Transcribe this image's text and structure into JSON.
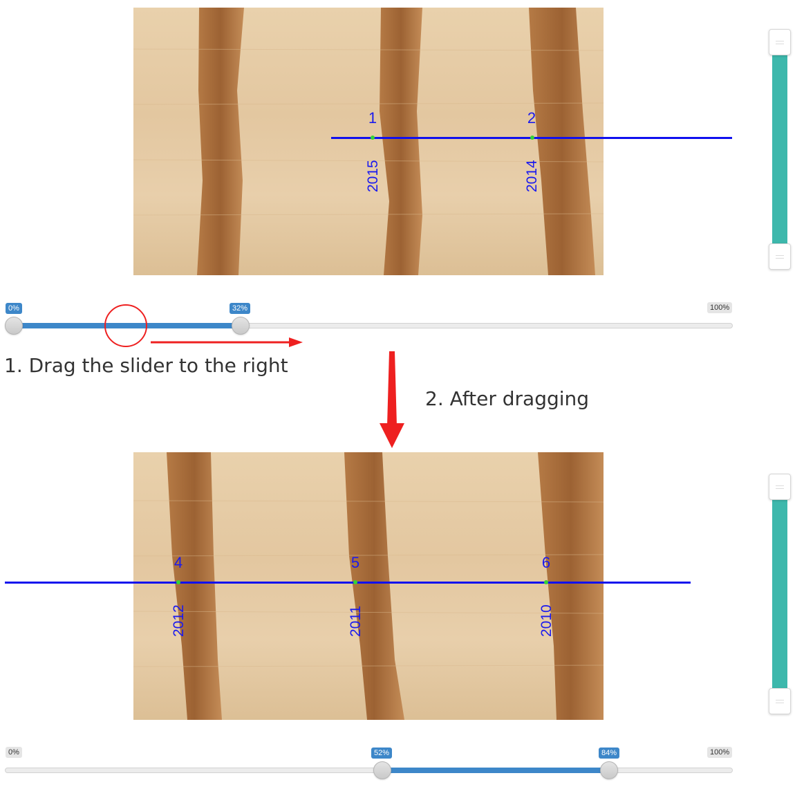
{
  "instructions": {
    "step1": "1. Drag the slider to the right",
    "step2": "2. After dragging"
  },
  "before": {
    "markers": [
      {
        "number": "1",
        "year": "2015"
      },
      {
        "number": "2",
        "year": "2014"
      }
    ],
    "slider": {
      "min_label": "0%",
      "max_label": "100%",
      "low_label": "0%",
      "high_label": "32%",
      "low_value": 0,
      "high_value": 32
    }
  },
  "after": {
    "markers": [
      {
        "number": "4",
        "year": "2012"
      },
      {
        "number": "5",
        "year": "2011"
      },
      {
        "number": "6",
        "year": "2010"
      }
    ],
    "slider": {
      "min_label": "0%",
      "max_label": "100%",
      "low_label": "52%",
      "high_label": "84%",
      "low_value": 52,
      "high_value": 84
    }
  },
  "colors": {
    "measure_line": "#1010ee",
    "point": "#36d436",
    "slider_fill": "#3d87c9",
    "vertical_slider_fill": "#3db8ac",
    "annotation_red": "#ee2020"
  },
  "icons": [
    "drag-target-circle-icon",
    "right-arrow-icon",
    "down-arrow-icon"
  ]
}
